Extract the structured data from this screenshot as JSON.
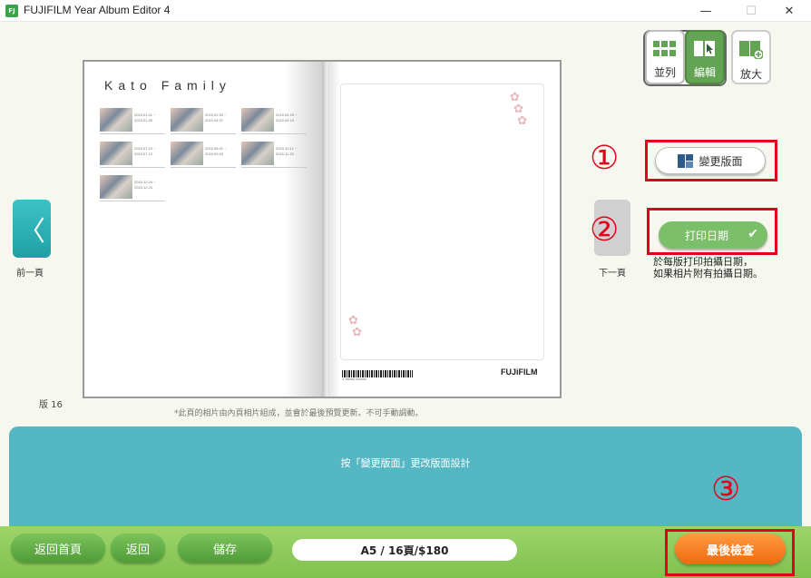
{
  "window": {
    "title": "FUJIFILM Year Album Editor 4",
    "app_icon_text": "FJ",
    "minimize": "—",
    "maximize": "☐",
    "close": "✕"
  },
  "modes": {
    "list_label": "並列",
    "edit_label": "編輯",
    "zoom_label": "放大",
    "active": "編輯"
  },
  "album": {
    "title": "Kato Family",
    "thumbs": [
      {
        "dates": "2015.01.01 ~ 2015.01.05"
      },
      {
        "dates": "2015.02.03 ~ 2015.04.07"
      },
      {
        "dates": "2015.05.15 ~ 2015.05.15"
      },
      {
        "dates": "2015.07.10 ~ 2015.07.10"
      },
      {
        "dates": "2015.08.01 ~ 2015.09.20"
      },
      {
        "dates": "2015.10.11 ~ 2015.11.15"
      },
      {
        "dates": "2015.12.24 ~ 2015.12.24"
      }
    ],
    "barcode_number": "9 784000 000000",
    "brand_logo": "FUJiFILM",
    "page_label": "版 16",
    "note": "*此頁的相片由內頁相片組成，並會於最後預覽更新。不可手動調動。"
  },
  "nav": {
    "prev_label": "前一頁",
    "next_label": "下一頁",
    "prev_glyph": "〈"
  },
  "controls": {
    "change_layout_label": "變更版面",
    "print_date_label": "打印日期",
    "print_date_desc_line1": "於每版打印拍攝日期，",
    "print_date_desc_line2": "如果相片附有拍攝日期。",
    "callout_1": "①",
    "callout_2": "②",
    "callout_3": "③"
  },
  "panel": {
    "instruction": "按「變更版面」更改版面設計"
  },
  "bottom": {
    "home_label": "返回首頁",
    "back_label": "返回",
    "save_label": "儲存",
    "status": "A5 / 16頁/$180",
    "final_label": "最後檢查"
  },
  "colors": {
    "teal": "#56b7c4",
    "green": "#7cbf6a",
    "orange": "#ef6a10",
    "callout_red": "#e3001b"
  }
}
